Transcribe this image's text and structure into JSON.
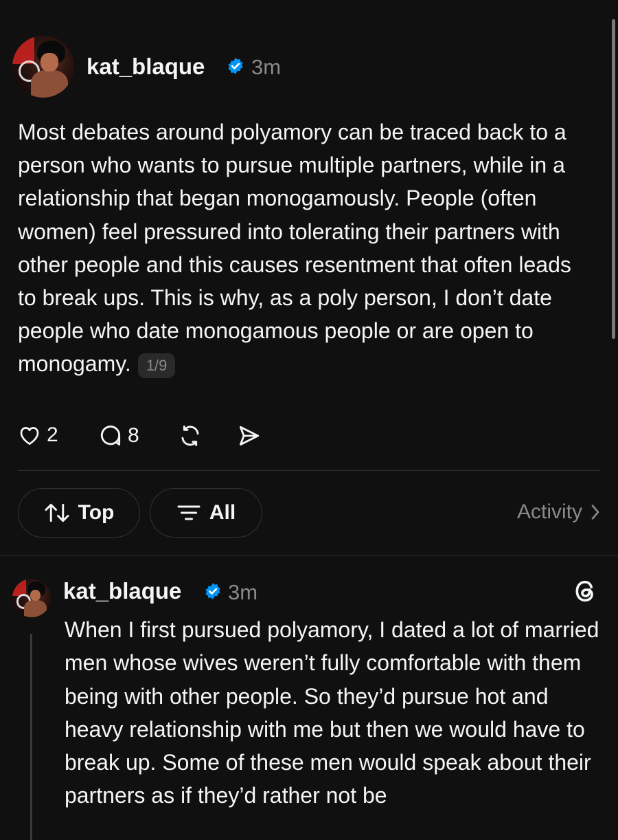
{
  "post": {
    "username": "kat_blaque",
    "time": "3m",
    "text": "Most debates around polyamory can be traced back to a person who wants to pursue multiple partners, while in a relationship that began monogamously. People (often women) feel pressured into tolerating their partners with other people and this causes resentment that often leads to break ups. This is why, as a poly person, I don’t date people who date monogamous people or are open to monogamy.",
    "thread_position": "1/9",
    "likes": "2",
    "comments": "8",
    "icons": [
      "heart-icon",
      "comment-icon",
      "repost-icon",
      "share-icon",
      "verified-icon"
    ]
  },
  "filters": {
    "sort_label": "Top",
    "filter_label": "All",
    "activity_label": "Activity"
  },
  "reply": {
    "username": "kat_blaque",
    "time": "3m",
    "text": "When I first pursued polyamory, I dated a lot of married men whose wives weren’t fully comfortable with them being with other people. So they’d pursue hot and heavy relationship with me but then we would have to break up. Some of these men would speak about their partners as if they’d rather not be",
    "icons": [
      "threads-icon",
      "verified-icon"
    ]
  },
  "colors": {
    "background": "#101010",
    "text": "#f3f5f7",
    "muted": "#8a8a8a",
    "verified": "#0095f6"
  }
}
